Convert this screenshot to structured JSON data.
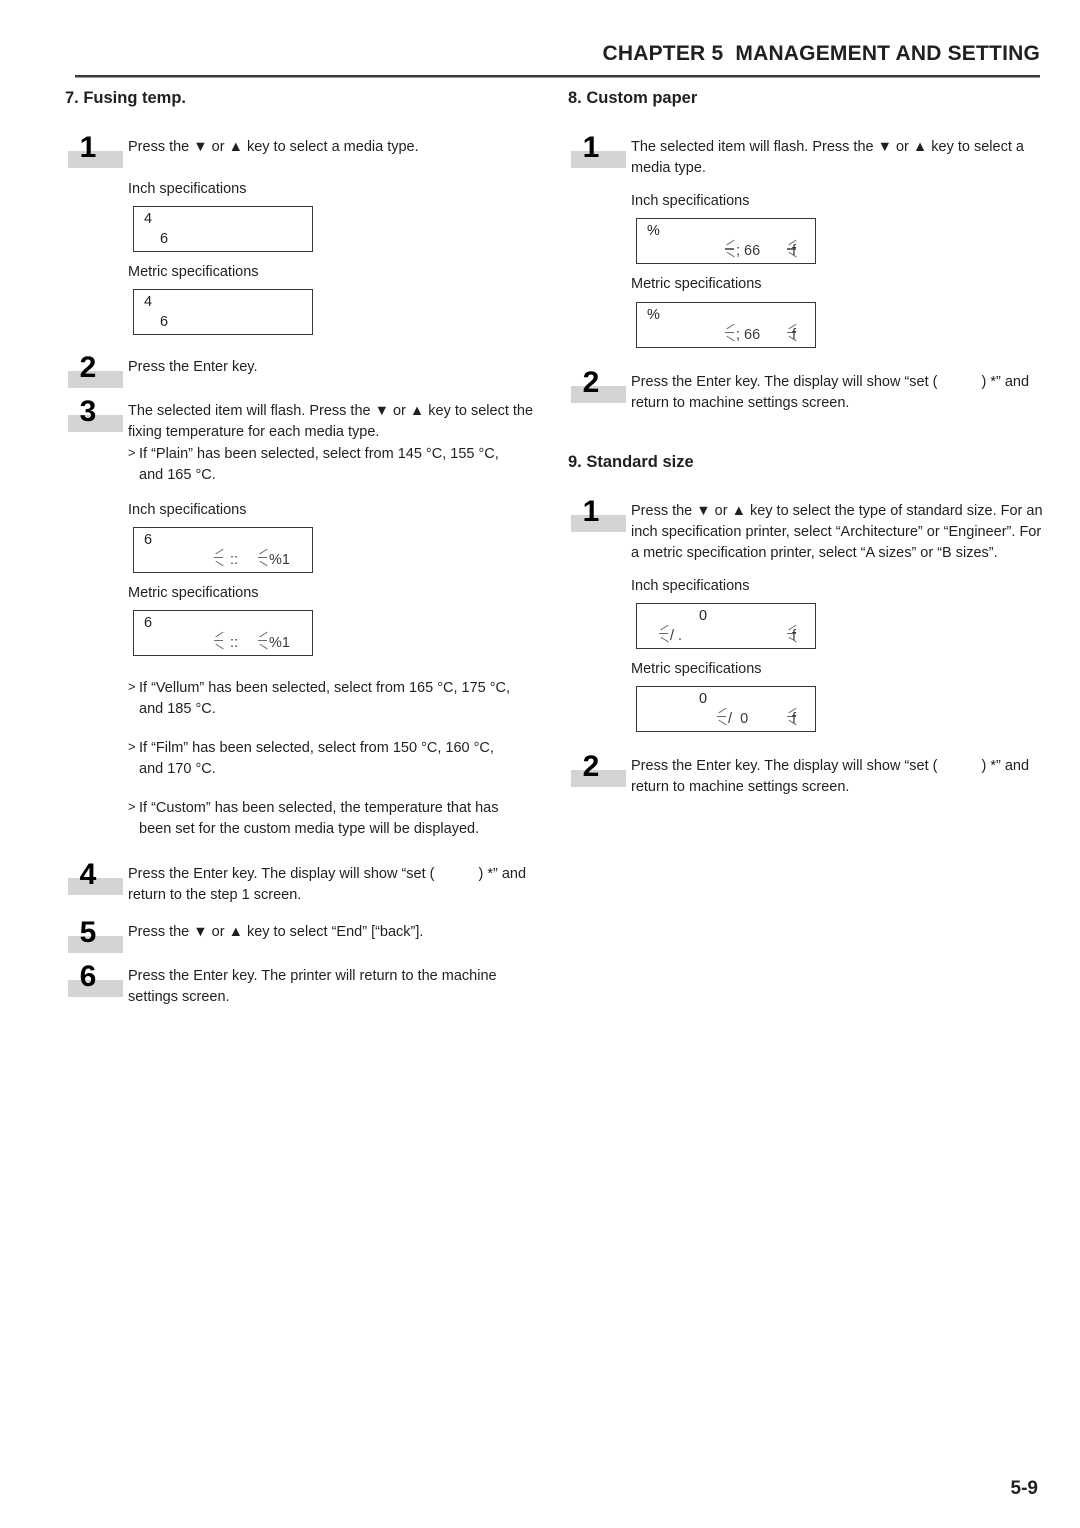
{
  "header": {
    "title": "CHAPTER 5  MANAGEMENT AND SETTING"
  },
  "page_number": "5-9",
  "labels": {
    "inch": "Inch specifications",
    "metric": "Metric specifications",
    "gt": ">"
  },
  "sections": {
    "fusing_temp": {
      "heading": "7. Fusing temp.",
      "step1": {
        "number": "1",
        "text": "Press the ▼ or ▲ key to select a media type.",
        "lcd_inch": {
          "line1": "4",
          "line2": "6"
        },
        "lcd_metric": {
          "line1": "4",
          "line2": "6"
        }
      },
      "step2": {
        "number": "2",
        "text": "Press the Enter key."
      },
      "step3": {
        "number": "3",
        "text": "The selected item will flash. Press the ▼ or ▲ key to select the fixing temperature for each media type.",
        "bullet_plain_line1": "If “Plain” has been selected, select from 145 °C, 155 °C,",
        "bullet_plain_line2": "and 165 °C.",
        "lcd_inch": {
          "line1": "6",
          "line2_a": "::",
          "line2_b": "%1"
        },
        "lcd_metric": {
          "line1": "6",
          "line2_a": "::",
          "line2_b": "%1"
        },
        "bullet_vellum_line1": "If “Vellum” has been selected, select from 165 °C, 175 °C,",
        "bullet_vellum_line2": "and 185 °C.",
        "bullet_film_line1": "If “Film” has been selected, select from 150 °C, 160 °C,",
        "bullet_film_line2": "and 170 °C.",
        "bullet_custom_line1": "If “Custom” has been selected, the temperature that has",
        "bullet_custom_line2": "been set for the custom media type will be displayed."
      },
      "step4": {
        "number": "4",
        "text_a": "Press the Enter key. The display will show “set (",
        "text_b": ") *” and",
        "text_c": "return to the step 1 screen."
      },
      "step5": {
        "number": "5",
        "text": "Press the ▼ or ▲ key to select “End” [“back”]."
      },
      "step6": {
        "number": "6",
        "text": "Press the Enter key. The printer will return to the machine settings screen."
      }
    },
    "custom_paper": {
      "heading": "8. Custom paper",
      "step1": {
        "number": "1",
        "text": "The selected item will flash. Press the ▼ or ▲ key to select a media type.",
        "lcd_inch": {
          "line1": "%",
          "line2_a": "; 66",
          "line2_b": "f"
        },
        "lcd_metric": {
          "line1": "%",
          "line2_a": "; 66",
          "line2_b": "f"
        }
      },
      "step2": {
        "number": "2",
        "text_a": "Press the Enter key. The display will show “set (",
        "text_b": ") *” and",
        "text_c": "return to machine settings screen."
      }
    },
    "standard_size": {
      "heading": "9. Standard size",
      "step1": {
        "number": "1",
        "text": "Press the ▼ or ▲ key to select the type of standard size. For an inch specification printer, select “Architecture” or “Engineer”. For a metric specification printer, select “A sizes” or “B sizes”.",
        "lcd_inch": {
          "line1": "0",
          "line2_a": "/ .",
          "line2_b": "f"
        },
        "lcd_metric": {
          "line1": "0",
          "line2_a": "/  0",
          "line2_b": "f"
        }
      },
      "step2": {
        "number": "2",
        "text_a": "Press the Enter key. The display will show “set (",
        "text_b": ") *” and",
        "text_c": "return to machine settings screen."
      }
    }
  }
}
